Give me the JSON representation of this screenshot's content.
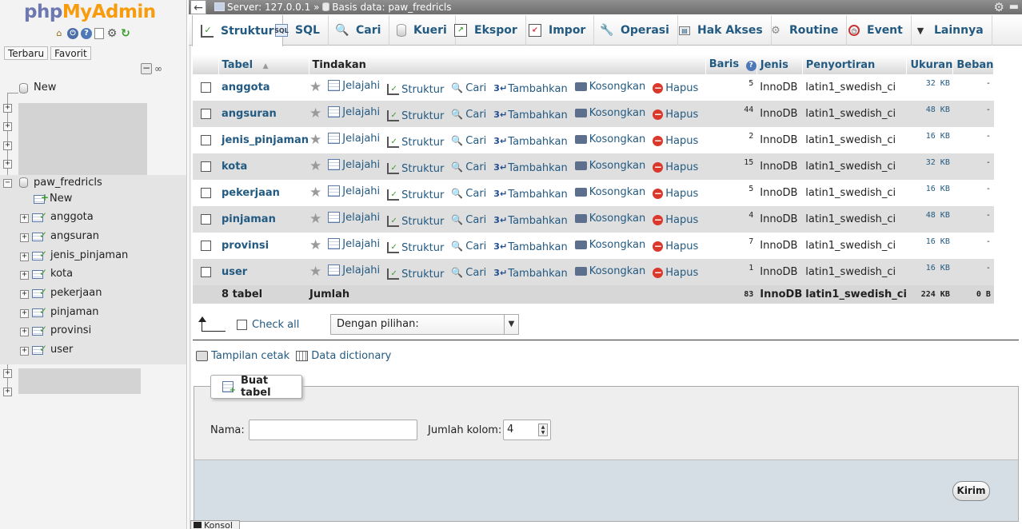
{
  "logo": {
    "part1": "php",
    "part2": "MyAdmin"
  },
  "nav": {
    "recent_tab": "Terbaru",
    "favorite_tab": "Favorit",
    "collapse_symbol": "−",
    "link_symbol": "∞",
    "new_label": "New",
    "current_db": "paw_fredricls",
    "db_new_label": "New",
    "tables": [
      "anggota",
      "angsuran",
      "jenis_pinjaman",
      "kota",
      "pekerjaan",
      "pinjaman",
      "provinsi",
      "user"
    ]
  },
  "topbar": {
    "server_label": "Server: 127.0.0.1",
    "separator": "»",
    "db_label": "Basis data: paw_fredricls"
  },
  "tabs": [
    "Struktur",
    "SQL",
    "Cari",
    "Kueri",
    "Ekspor",
    "Impor",
    "Operasi",
    "Hak Akses",
    "Routine",
    "Event",
    "Lainnya"
  ],
  "table": {
    "headers": {
      "tabel": "Tabel",
      "sort_symbol": "▲",
      "tindakan": "Tindakan",
      "baris": "Baris",
      "jenis": "Jenis",
      "penyortiran": "Penyortiran",
      "ukuran": "Ukuran",
      "beban": "Beban"
    },
    "actions": {
      "browse": "Jelajahi",
      "structure": "Struktur",
      "search": "Cari",
      "insert": "Tambahkan",
      "empty": "Kosongkan",
      "drop": "Hapus"
    },
    "rows": [
      {
        "name": "anggota",
        "rows": "5",
        "engine": "InnoDB",
        "collation": "latin1_swedish_ci",
        "size": "32 KB",
        "overhead": "-"
      },
      {
        "name": "angsuran",
        "rows": "44",
        "engine": "InnoDB",
        "collation": "latin1_swedish_ci",
        "size": "48 KB",
        "overhead": "-"
      },
      {
        "name": "jenis_pinjaman",
        "rows": "2",
        "engine": "InnoDB",
        "collation": "latin1_swedish_ci",
        "size": "16 KB",
        "overhead": "-"
      },
      {
        "name": "kota",
        "rows": "15",
        "engine": "InnoDB",
        "collation": "latin1_swedish_ci",
        "size": "32 KB",
        "overhead": "-"
      },
      {
        "name": "pekerjaan",
        "rows": "5",
        "engine": "InnoDB",
        "collation": "latin1_swedish_ci",
        "size": "16 KB",
        "overhead": "-"
      },
      {
        "name": "pinjaman",
        "rows": "4",
        "engine": "InnoDB",
        "collation": "latin1_swedish_ci",
        "size": "48 KB",
        "overhead": "-"
      },
      {
        "name": "provinsi",
        "rows": "7",
        "engine": "InnoDB",
        "collation": "latin1_swedish_ci",
        "size": "16 KB",
        "overhead": "-"
      },
      {
        "name": "user",
        "rows": "1",
        "engine": "InnoDB",
        "collation": "latin1_swedish_ci",
        "size": "16 KB",
        "overhead": "-"
      }
    ],
    "footer": {
      "count": "8 tabel",
      "label": "Jumlah",
      "rows": "83",
      "engine": "InnoDB",
      "collation": "latin1_swedish_ci",
      "size": "224 KB",
      "overhead": "0 B"
    }
  },
  "bulk": {
    "check_all": "Check all",
    "with_selected": "Dengan pilihan:"
  },
  "links": {
    "print_view": "Tampilan cetak",
    "data_dictionary": "Data dictionary"
  },
  "create_table": {
    "legend": "Buat tabel",
    "name_label": "Nama:",
    "name_value": "",
    "columns_label": "Jumlah kolom:",
    "columns_value": "4",
    "submit": "Kirim"
  },
  "console": {
    "label": "Konsol"
  },
  "colors": {
    "link": "#235a81",
    "logo_php": "#6c78af",
    "logo_myadmin": "#f89c0e",
    "odd_row": "#ffffff",
    "even_row": "#dfdfdf"
  }
}
